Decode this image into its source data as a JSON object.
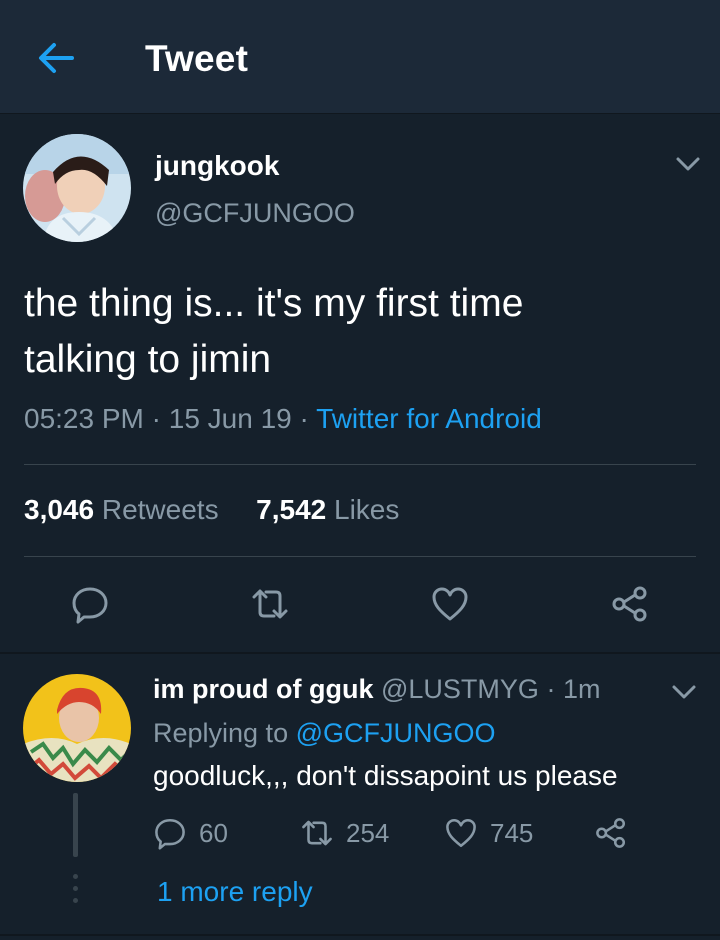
{
  "header": {
    "title": "Tweet",
    "back_icon": "arrow-left-icon"
  },
  "tweet": {
    "author_name": "jungkook",
    "author_handle": "@GCFJUNGOO",
    "text_line1": "the thing is... it's my first time",
    "text_line2": "talking to jimin",
    "time": "05:23 PM",
    "date": "15 Jun 19",
    "source": "Twitter for Android",
    "retweets_count": "3,046",
    "retweets_label": "Retweets",
    "likes_count": "7,542",
    "likes_label": "Likes",
    "actions": [
      "reply-icon",
      "retweet-icon",
      "like-icon",
      "share-icon"
    ]
  },
  "reply": {
    "author_name": "im proud of gguk",
    "author_handle": "@LUSTMYG",
    "age": "1m",
    "replying_prefix": "Replying to",
    "replying_to": "@GCFJUNGOO",
    "text": "goodluck,,, don't dissapoint us please",
    "reply_count": "60",
    "retweet_count": "254",
    "like_count": "745",
    "more_replies": "1 more reply"
  },
  "colors": {
    "background": "#15202b",
    "header": "#1c2938",
    "accent": "#1da1f2",
    "muted": "#8899a6",
    "divider": "#38444d"
  }
}
